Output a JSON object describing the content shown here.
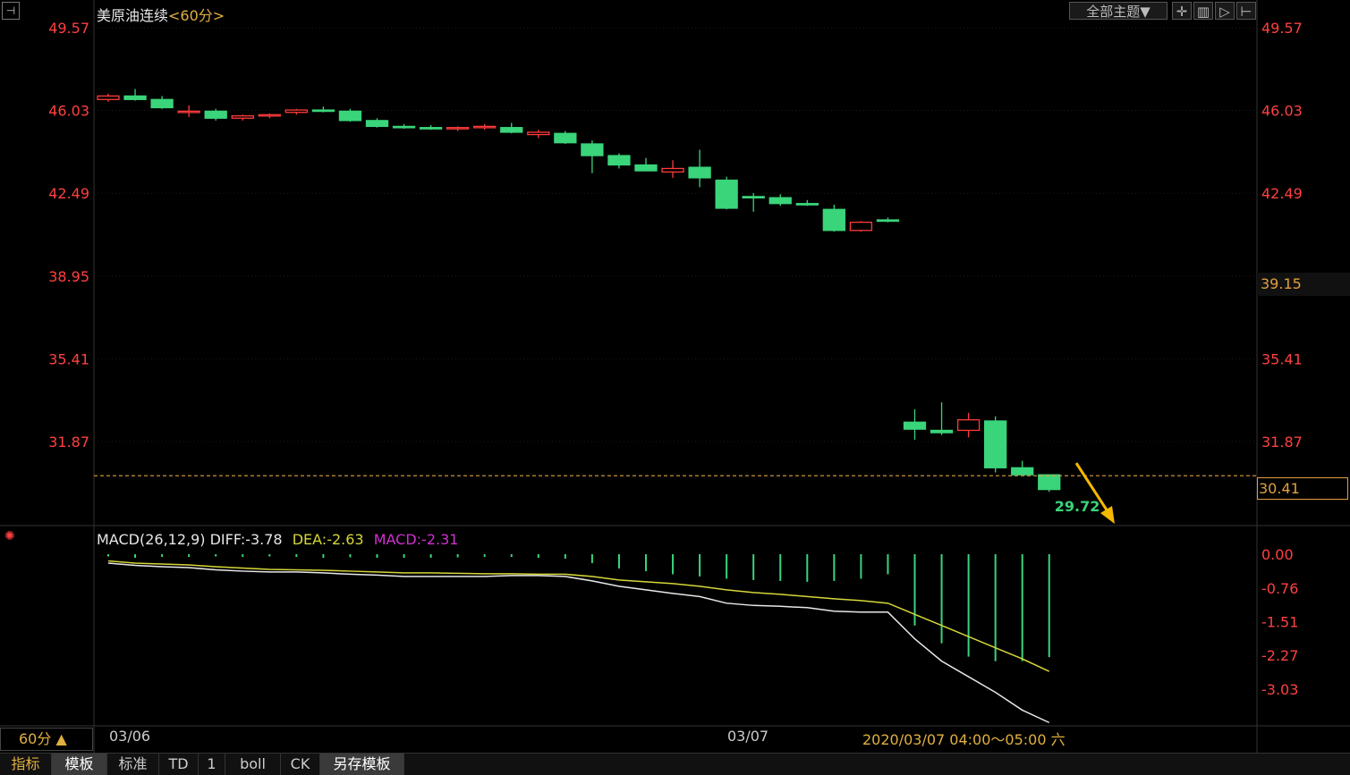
{
  "title": {
    "name": "美原油连续",
    "period": "<60分>"
  },
  "top_buttons": {
    "theme_label": "全部主题▼"
  },
  "price_axis": {
    "left_ticks": [
      "49.57",
      "46.03",
      "42.49",
      "38.95",
      "35.41",
      "31.87"
    ],
    "right_ticks": [
      "49.57",
      "46.03",
      "42.49",
      "35.41",
      "31.87"
    ],
    "marker_label": "39.15",
    "last_price_label": "30.41",
    "low_label": "29.72"
  },
  "macd": {
    "name": "MACD(26,12,9)",
    "diff_label": "DIFF:-3.78",
    "dea_label": "DEA:-2.63",
    "macd_label": "MACD:-2.31",
    "ticks": [
      "0.00",
      "-0.76",
      "-1.51",
      "-2.27",
      "-3.03"
    ]
  },
  "time_axis": {
    "labels": [
      "03/06",
      "03/07"
    ],
    "range_label": "2020/03/07 04:00～05:00 六"
  },
  "bottom": {
    "period_label": "60分 ▲",
    "tabs": [
      "指标",
      "模板",
      "标准",
      "TD",
      "1",
      "boll",
      "CK",
      "另存模板"
    ]
  },
  "colors": {
    "up": "#ff3b3b",
    "down": "#3ad47a",
    "dea": "#d6d63a",
    "diff": "#e8e8e8",
    "last": "#e0a040"
  },
  "chart_data": {
    "type": "candlestick",
    "ylim": [
      29.0,
      49.57
    ],
    "candles": [
      {
        "o": 46.5,
        "h": 46.75,
        "l": 46.4,
        "c": 46.65
      },
      {
        "o": 46.65,
        "h": 46.95,
        "l": 46.45,
        "c": 46.5
      },
      {
        "o": 46.5,
        "h": 46.65,
        "l": 46.1,
        "c": 46.15
      },
      {
        "o": 46.0,
        "h": 46.25,
        "l": 45.75,
        "c": 46.0
      },
      {
        "o": 46.0,
        "h": 46.1,
        "l": 45.6,
        "c": 45.7
      },
      {
        "o": 45.7,
        "h": 45.85,
        "l": 45.6,
        "c": 45.8
      },
      {
        "o": 45.8,
        "h": 45.9,
        "l": 45.7,
        "c": 45.85
      },
      {
        "o": 45.95,
        "h": 46.1,
        "l": 45.85,
        "c": 46.05
      },
      {
        "o": 46.05,
        "h": 46.2,
        "l": 45.95,
        "c": 46.0
      },
      {
        "o": 46.0,
        "h": 46.1,
        "l": 45.55,
        "c": 45.6
      },
      {
        "o": 45.6,
        "h": 45.7,
        "l": 45.3,
        "c": 45.35
      },
      {
        "o": 45.35,
        "h": 45.45,
        "l": 45.25,
        "c": 45.3
      },
      {
        "o": 45.3,
        "h": 45.4,
        "l": 45.2,
        "c": 45.25
      },
      {
        "o": 45.25,
        "h": 45.35,
        "l": 45.15,
        "c": 45.3
      },
      {
        "o": 45.3,
        "h": 45.45,
        "l": 45.2,
        "c": 45.35
      },
      {
        "o": 45.3,
        "h": 45.5,
        "l": 45.05,
        "c": 45.1
      },
      {
        "o": 45.0,
        "h": 45.2,
        "l": 44.85,
        "c": 45.1
      },
      {
        "o": 45.05,
        "h": 45.15,
        "l": 44.6,
        "c": 44.65
      },
      {
        "o": 44.6,
        "h": 44.75,
        "l": 43.35,
        "c": 44.1
      },
      {
        "o": 44.1,
        "h": 44.2,
        "l": 43.55,
        "c": 43.7
      },
      {
        "o": 43.7,
        "h": 44.0,
        "l": 43.5,
        "c": 43.45
      },
      {
        "o": 43.4,
        "h": 43.9,
        "l": 43.15,
        "c": 43.55
      },
      {
        "o": 43.6,
        "h": 44.35,
        "l": 42.75,
        "c": 43.15
      },
      {
        "o": 43.05,
        "h": 43.2,
        "l": 41.8,
        "c": 41.85
      },
      {
        "o": 42.35,
        "h": 42.5,
        "l": 41.7,
        "c": 42.3
      },
      {
        "o": 42.3,
        "h": 42.45,
        "l": 41.95,
        "c": 42.05
      },
      {
        "o": 42.05,
        "h": 42.2,
        "l": 41.95,
        "c": 42.0
      },
      {
        "o": 41.8,
        "h": 42.0,
        "l": 40.85,
        "c": 40.9
      },
      {
        "o": 40.9,
        "h": 41.3,
        "l": 40.85,
        "c": 41.25
      },
      {
        "o": 41.35,
        "h": 41.45,
        "l": 41.25,
        "c": 41.3
      },
      {
        "o": 32.7,
        "h": 33.25,
        "l": 31.95,
        "c": 32.4
      },
      {
        "o": 32.35,
        "h": 33.55,
        "l": 32.15,
        "c": 32.25
      },
      {
        "o": 32.35,
        "h": 33.1,
        "l": 32.05,
        "c": 32.8
      },
      {
        "o": 32.75,
        "h": 32.95,
        "l": 30.55,
        "c": 30.75
      },
      {
        "o": 30.75,
        "h": 31.05,
        "l": 30.6,
        "c": 30.45
      },
      {
        "o": 30.45,
        "h": 30.45,
        "l": 29.72,
        "c": 29.82
      }
    ],
    "candle_slots": [
      0,
      1,
      2,
      3,
      4,
      5,
      6,
      7,
      8,
      9,
      10,
      11,
      12,
      13,
      14,
      15,
      16,
      17,
      18,
      19,
      20,
      21,
      22,
      23,
      24,
      25,
      26,
      27,
      28,
      29,
      30,
      31,
      32,
      33,
      34,
      35
    ],
    "last_price": 30.41,
    "macd_ylim": [
      -3.6,
      0.2
    ],
    "macd_hist": [
      -0.05,
      -0.08,
      -0.06,
      -0.06,
      -0.05,
      -0.06,
      -0.05,
      -0.06,
      -0.08,
      -0.07,
      -0.08,
      -0.08,
      -0.08,
      -0.07,
      -0.06,
      -0.06,
      -0.08,
      -0.1,
      -0.2,
      -0.32,
      -0.38,
      -0.45,
      -0.5,
      -0.55,
      -0.58,
      -0.6,
      -0.62,
      -0.6,
      -0.55,
      -0.45,
      -1.6,
      -2.0,
      -2.3,
      -2.4,
      -2.4,
      -2.31
    ],
    "diff": [
      -0.2,
      -0.25,
      -0.28,
      -0.3,
      -0.35,
      -0.38,
      -0.4,
      -0.4,
      -0.42,
      -0.45,
      -0.47,
      -0.5,
      -0.5,
      -0.5,
      -0.5,
      -0.48,
      -0.48,
      -0.5,
      -0.6,
      -0.72,
      -0.8,
      -0.88,
      -0.95,
      -1.1,
      -1.15,
      -1.17,
      -1.2,
      -1.28,
      -1.3,
      -1.3,
      -1.9,
      -2.4,
      -2.75,
      -3.1,
      -3.5,
      -3.78
    ],
    "dea": [
      -0.15,
      -0.2,
      -0.22,
      -0.24,
      -0.28,
      -0.31,
      -0.34,
      -0.35,
      -0.36,
      -0.38,
      -0.4,
      -0.42,
      -0.42,
      -0.43,
      -0.44,
      -0.44,
      -0.45,
      -0.45,
      -0.5,
      -0.58,
      -0.62,
      -0.66,
      -0.72,
      -0.8,
      -0.86,
      -0.9,
      -0.95,
      -1.0,
      -1.04,
      -1.1,
      -1.35,
      -1.6,
      -1.85,
      -2.1,
      -2.35,
      -2.63
    ]
  }
}
